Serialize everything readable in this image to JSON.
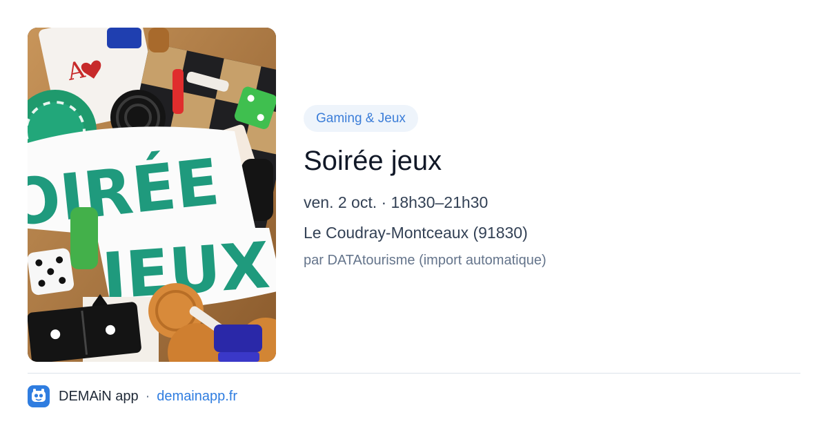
{
  "event": {
    "image_text": "SOIRÉE JEUX",
    "category": "Gaming & Jeux",
    "title": "Soirée jeux",
    "datetime": "ven. 2 oct. · 18h30–21h30",
    "location": "Le Coudray-Montceaux (91830)",
    "source": "par DATAtourisme (import automatique)"
  },
  "footer": {
    "logo_icon": "demain-app-logo-icon",
    "app_name": "DEMAiN app",
    "separator": "·",
    "domain": "demainapp.fr"
  },
  "colors": {
    "accent": "#3b7dd8",
    "pill_background": "#eef4fb",
    "title": "#111827",
    "muted": "#64748b",
    "image_text_green": "#1f9a7d"
  }
}
